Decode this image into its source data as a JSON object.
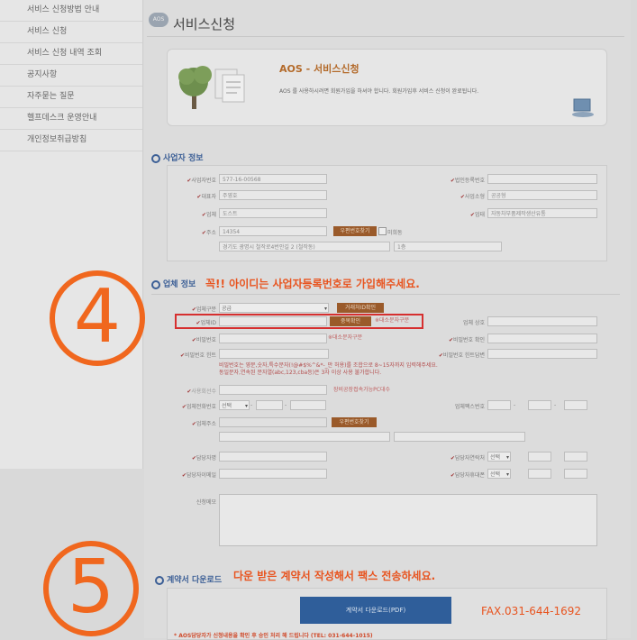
{
  "sidebar": {
    "items": [
      "서비스 신청방법 안내",
      "서비스 신청",
      "서비스 신청 내역 조회",
      "공지사항",
      "자주묻는 질문",
      "헬프데스크 운영안내",
      "개인정보취급방침"
    ]
  },
  "header": {
    "icon": "AOS",
    "title": "서비스신청"
  },
  "banner": {
    "title": "AOS - 서비스신청",
    "desc": "AOS 를 사용하시려면 회원가입을 하셔야 합니다. 회원가입후 서비스 신청이 완료됩니다."
  },
  "business": {
    "section_title": "사업자 정보",
    "labels": {
      "biz_no": "사업자번호",
      "name": "대표자",
      "company": "업체",
      "address": "주소",
      "corp_no": "법인등록번호",
      "type": "사업소형",
      "item": "업태"
    },
    "values": {
      "biz_no": "577-16-00568",
      "name": "주영호",
      "company": "도스트",
      "zip": "14354",
      "addr1": "경기도 광명시 철작로4번안길 2 (철작동)",
      "addr2": "1층",
      "type": "공공형",
      "item": "자동차부품제작생산유통",
      "corp_no": ""
    },
    "zip_button": "우편번호찾기",
    "checkbox_label": "미희동"
  },
  "company": {
    "section_title": "업체 정보",
    "notice": "꼭!! 아이디는 사업자등록번호로 가입해주세요.",
    "labels": {
      "type": "업체구분",
      "id": "업체ID",
      "pw": "비밀번호",
      "hint": "비밀번호 힌트",
      "rate": "사용회선수",
      "phone": "업체전화번호",
      "addr": "업체주소",
      "manager": "담당자명",
      "email": "담당자이메일",
      "memo": "신청메모",
      "company_name": "업체 상호",
      "pw_confirm": "비밀번호 확인",
      "hint_answer": "비밀번호 힌트답변",
      "fax": "업체팩스번호",
      "manager_phone": "담당자연락처",
      "manager_mobile": "담당자휴대폰"
    },
    "type_value": "공급",
    "type_button": "거래처ID확인",
    "id_button": "중복확인",
    "id_hint": "※대소문자구분",
    "pw_hint": "※대소문자구분",
    "pw_rule": "비밀번호는 영문,숫자,특수문자(!@#$%^&*-_만 허용)를 조합으로 8~15자까지 입력해주세요.",
    "pw_rule2": "동일문자,연속된 문자열(abc,123,cba등)은 3자 이상 사용 불가합니다.",
    "rate_note": "장비공장접속가능PC대수",
    "phone_select": "선택",
    "zip_button": "우편번호찾기",
    "manager_phone_select": "선택",
    "manager_mobile_select": "선택"
  },
  "contract": {
    "section_title": "계약서 다운로드",
    "notice": "다운 받은 계약서 작성해서 팩스 전송하세요.",
    "download_button": "계약서 다운로드(PDF)",
    "fax": "FAX.031-644-1692",
    "footer": "* AOS담당자가 신청내용을 확인 후 승인 처리 해 드립니다 (TEL: 031-644-1015)"
  },
  "annotations": {
    "step4": "4",
    "step5": "5"
  },
  "colors": {
    "accent_orange": "#f0671e",
    "highlight_red": "#d62f2f",
    "button_blue": "#2f5e9a",
    "button_brown": "#9a5a2a"
  }
}
